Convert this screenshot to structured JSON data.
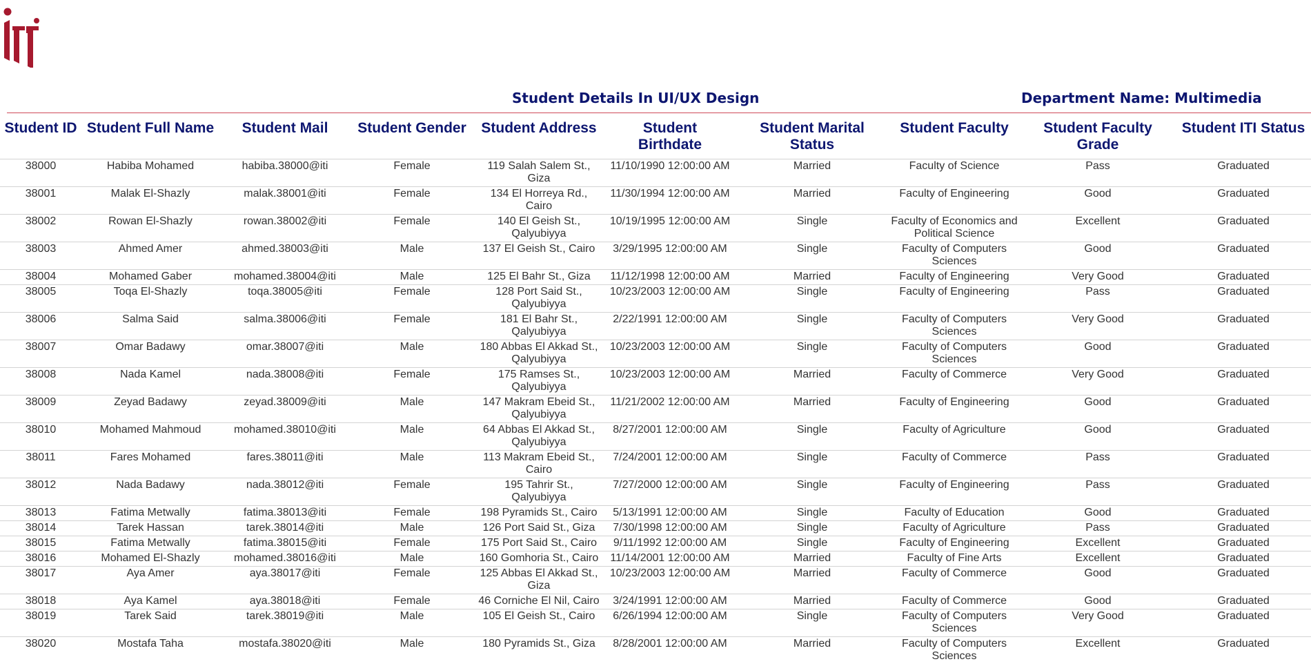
{
  "logo": {
    "alt": "iti",
    "color": "#a6192e"
  },
  "report": {
    "title": "Student Details In UI/UX Design",
    "department": "Department Name: Multimedia"
  },
  "table": {
    "headers": [
      "Student ID",
      "Student Full Name",
      "Student Mail",
      "Student Gender",
      "Student Address",
      "Student Birthdate",
      "Student Marital Status",
      "Student Faculty",
      "Student Faculty Grade",
      "Student ITI Status"
    ],
    "rows": [
      [
        "38000",
        "Habiba Mohamed",
        "habiba.38000@iti",
        "Female",
        "119 Salah Salem St., Giza",
        "11/10/1990 12:00:00 AM",
        "Married",
        "Faculty of Science",
        "Pass",
        "Graduated"
      ],
      [
        "38001",
        "Malak El-Shazly",
        "malak.38001@iti",
        "Female",
        "134 El Horreya Rd., Cairo",
        "11/30/1994 12:00:00 AM",
        "Married",
        "Faculty of Engineering",
        "Good",
        "Graduated"
      ],
      [
        "38002",
        "Rowan El-Shazly",
        "rowan.38002@iti",
        "Female",
        "140 El Geish St., Qalyubiyya",
        "10/19/1995 12:00:00 AM",
        "Single",
        "Faculty of Economics and Political Science",
        "Excellent",
        "Graduated"
      ],
      [
        "38003",
        "Ahmed Amer",
        "ahmed.38003@iti",
        "Male",
        "137 El Geish St., Cairo",
        "3/29/1995 12:00:00 AM",
        "Single",
        "Faculty of Computers Sciences",
        "Good",
        "Graduated"
      ],
      [
        "38004",
        "Mohamed Gaber",
        "mohamed.38004@iti",
        "Male",
        "125 El Bahr St., Giza",
        "11/12/1998 12:00:00 AM",
        "Married",
        "Faculty of Engineering",
        "Very Good",
        "Graduated"
      ],
      [
        "38005",
        "Toqa El-Shazly",
        "toqa.38005@iti",
        "Female",
        "128 Port Said St., Qalyubiyya",
        "10/23/2003 12:00:00 AM",
        "Single",
        "Faculty of Engineering",
        "Pass",
        "Graduated"
      ],
      [
        "38006",
        "Salma Said",
        "salma.38006@iti",
        "Female",
        "181 El Bahr St., Qalyubiyya",
        "2/22/1991 12:00:00 AM",
        "Single",
        "Faculty of Computers Sciences",
        "Very Good",
        "Graduated"
      ],
      [
        "38007",
        "Omar Badawy",
        "omar.38007@iti",
        "Male",
        "180 Abbas El Akkad St., Qalyubiyya",
        "10/23/2003 12:00:00 AM",
        "Single",
        "Faculty of Computers Sciences",
        "Good",
        "Graduated"
      ],
      [
        "38008",
        "Nada Kamel",
        "nada.38008@iti",
        "Female",
        "175 Ramses St., Qalyubiyya",
        "10/23/2003 12:00:00 AM",
        "Married",
        "Faculty of Commerce",
        "Very Good",
        "Graduated"
      ],
      [
        "38009",
        "Zeyad Badawy",
        "zeyad.38009@iti",
        "Male",
        "147 Makram Ebeid St., Qalyubiyya",
        "11/21/2002 12:00:00 AM",
        "Married",
        "Faculty of Engineering",
        "Good",
        "Graduated"
      ],
      [
        "38010",
        "Mohamed Mahmoud",
        "mohamed.38010@iti",
        "Male",
        "64 Abbas El Akkad St., Qalyubiyya",
        "8/27/2001 12:00:00 AM",
        "Single",
        "Faculty of Agriculture",
        "Good",
        "Graduated"
      ],
      [
        "38011",
        "Fares Mohamed",
        "fares.38011@iti",
        "Male",
        "113 Makram Ebeid St., Cairo",
        "7/24/2001 12:00:00 AM",
        "Single",
        "Faculty of Commerce",
        "Pass",
        "Graduated"
      ],
      [
        "38012",
        "Nada Badawy",
        "nada.38012@iti",
        "Female",
        "195 Tahrir St., Qalyubiyya",
        "7/27/2000 12:00:00 AM",
        "Single",
        "Faculty of Engineering",
        "Pass",
        "Graduated"
      ],
      [
        "38013",
        "Fatima Metwally",
        "fatima.38013@iti",
        "Female",
        "198 Pyramids St., Cairo",
        "5/13/1991 12:00:00 AM",
        "Single",
        "Faculty of Education",
        "Good",
        "Graduated"
      ],
      [
        "38014",
        "Tarek Hassan",
        "tarek.38014@iti",
        "Male",
        "126 Port Said St., Giza",
        "7/30/1998 12:00:00 AM",
        "Single",
        "Faculty of Agriculture",
        "Pass",
        "Graduated"
      ],
      [
        "38015",
        "Fatima Metwally",
        "fatima.38015@iti",
        "Female",
        "175 Port Said St., Cairo",
        "9/11/1992 12:00:00 AM",
        "Single",
        "Faculty of Engineering",
        "Excellent",
        "Graduated"
      ],
      [
        "38016",
        "Mohamed El-Shazly",
        "mohamed.38016@iti",
        "Male",
        "160 Gomhoria St., Cairo",
        "11/14/2001 12:00:00 AM",
        "Married",
        "Faculty of Fine Arts",
        "Excellent",
        "Graduated"
      ],
      [
        "38017",
        "Aya Amer",
        "aya.38017@iti",
        "Female",
        "125 Abbas El Akkad St., Giza",
        "10/23/2003 12:00:00 AM",
        "Married",
        "Faculty of Commerce",
        "Good",
        "Graduated"
      ],
      [
        "38018",
        "Aya Kamel",
        "aya.38018@iti",
        "Female",
        "46 Corniche El Nil, Cairo",
        "3/24/1991 12:00:00 AM",
        "Married",
        "Faculty of Commerce",
        "Good",
        "Graduated"
      ],
      [
        "38019",
        "Tarek Said",
        "tarek.38019@iti",
        "Male",
        "105 El Geish St., Cairo",
        "6/26/1994 12:00:00 AM",
        "Single",
        "Faculty of Computers Sciences",
        "Very Good",
        "Graduated"
      ],
      [
        "38020",
        "Mostafa Taha",
        "mostafa.38020@iti",
        "Male",
        "180 Pyramids St., Giza",
        "8/28/2001 12:00:00 AM",
        "Married",
        "Faculty of Computers Sciences",
        "Excellent",
        "Graduated"
      ]
    ]
  }
}
